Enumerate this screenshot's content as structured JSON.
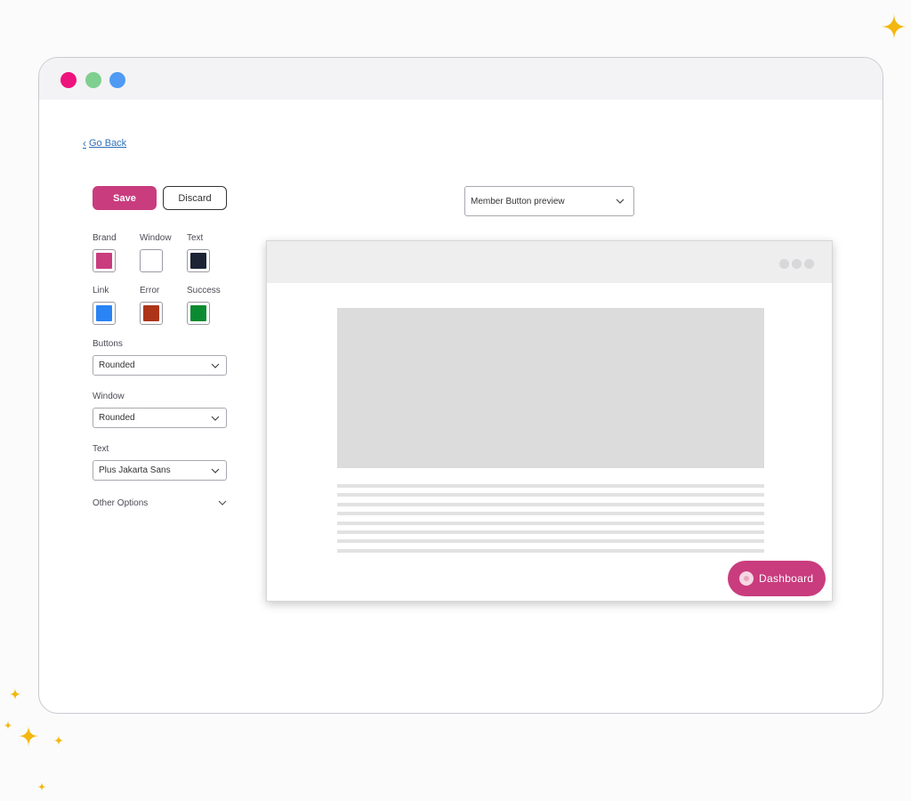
{
  "colors": {
    "brand": "#c93c7e",
    "page_bg": "#fbfbfc",
    "sparkle": "#f3b70f",
    "traffic_red": "#ee127c",
    "traffic_green": "#7fcf91",
    "traffic_blue": "#4f9af3"
  },
  "nav": {
    "go_back": "Go Back"
  },
  "toolbar": {
    "save_label": "Save",
    "discard_label": "Discard"
  },
  "swatches": [
    {
      "label": "Brand",
      "color": "#c93c7e"
    },
    {
      "label": "Window",
      "color": "#ffffff"
    },
    {
      "label": "Text",
      "color": "#1c2335"
    },
    {
      "label": "Link",
      "color": "#2a84f4"
    },
    {
      "label": "Error",
      "color": "#ad3419"
    },
    {
      "label": "Success",
      "color": "#0b8b30"
    }
  ],
  "settings": {
    "buttons_label": "Buttons",
    "buttons_value": "Rounded",
    "window_label": "Window",
    "window_value": "Rounded",
    "text_label": "Text",
    "text_value": "Plus Jakarta Sans",
    "other_options": "Other Options"
  },
  "preview": {
    "select_value": "Member Button preview",
    "dashboard_label": "Dashboard",
    "line_count": 8
  }
}
